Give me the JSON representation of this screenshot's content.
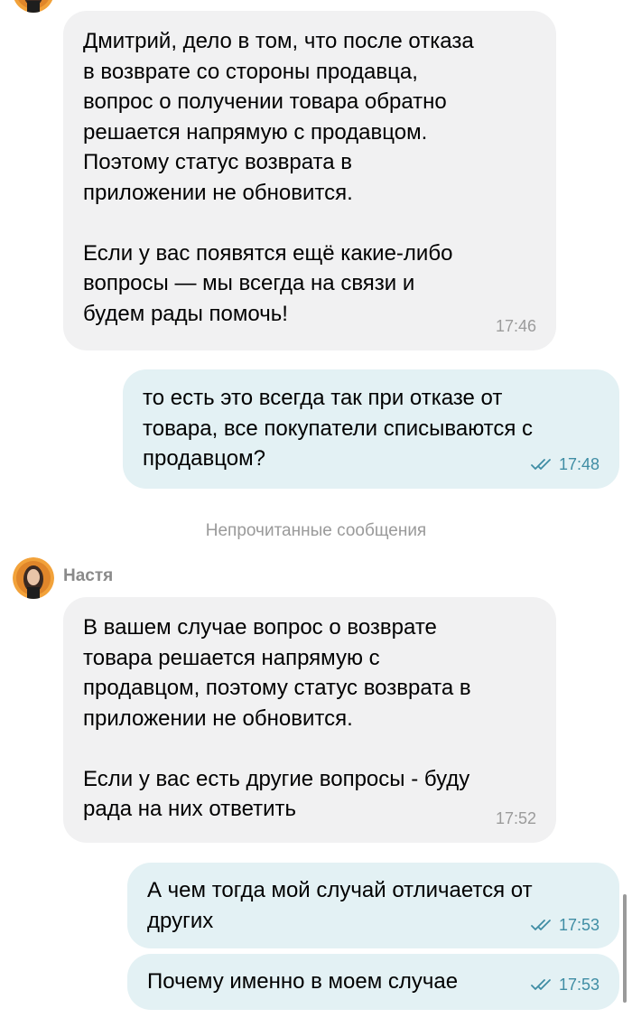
{
  "chat": {
    "messages": [
      {
        "direction": "incoming",
        "text": "Дмитрий, дело в том, что после отказа\nв возврате со стороны продавца,\nвопрос о получении товара обратно\nрешается напрямую с продавцом.\nПоэтому статус возврата в\nприложении не обновится.\n\nЕсли у вас появятся ещё какие-либо\nвопросы — мы всегда на связи и\nбудем рады помочь!",
        "time": "17:46"
      },
      {
        "direction": "outgoing",
        "text": "то есть это всегда так при отказе от\nтовара, все покупатели списываются с\nпродавцом?",
        "time": "17:48",
        "status": "read"
      }
    ],
    "unread_divider": "Непрочитанные сообщения",
    "sender": {
      "name": "Настя"
    },
    "unread_messages": [
      {
        "direction": "incoming",
        "text": "В вашем случае вопрос о возврате\nтовара решается напрямую с\nпродавцом, поэтому статус возврата в\nприложении не обновится.\n\nЕсли у вас есть другие вопросы - буду\nрада на них ответить",
        "time": "17:52"
      },
      {
        "direction": "outgoing",
        "text": "А чем тогда мой случай отличается от\nдругих",
        "time": "17:53",
        "status": "read"
      },
      {
        "direction": "outgoing",
        "text": "Почему именно в моем случае",
        "time": "17:53",
        "status": "read"
      }
    ]
  },
  "colors": {
    "incoming_bubble": "#f1f1f2",
    "outgoing_bubble": "#e3f1f4",
    "outgoing_meta": "#3f8da4",
    "incoming_meta": "#9b9b9b",
    "avatar_ring": "#f2a23a"
  },
  "icons": {
    "avatar": "user-avatar-photo",
    "read_status": "double-check-icon"
  }
}
